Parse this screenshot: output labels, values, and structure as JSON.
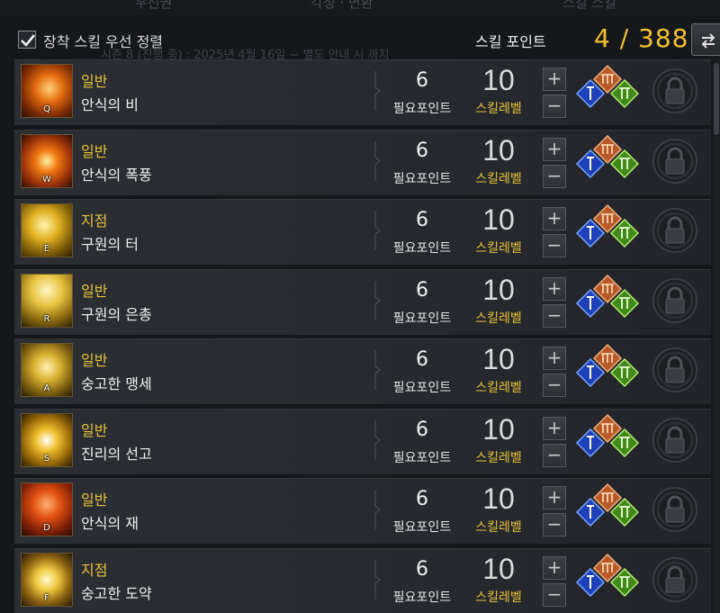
{
  "top": {
    "tabs": [
      "우선권",
      "각성 · 변환",
      "스킬 스킬"
    ],
    "notice": "시즌 8 (진행 중) : 2025년 4월 16일 ~ 별도 안내 시 까지"
  },
  "header": {
    "sort_label": "장착 스킬 우선 정렬",
    "sort_checked": true,
    "skill_point_label": "스킬 포인트",
    "skill_point_value": "4 / 388"
  },
  "labels": {
    "points_label": "필요포인트",
    "level_label": "스킬레벨",
    "plus": "+",
    "minus": "−"
  },
  "colors": {
    "category": "#e8c23a",
    "points_value": "#f2c230"
  },
  "skills": [
    {
      "key": "Q",
      "category": "일반",
      "name": "안식의 비",
      "points": "6",
      "level": "10",
      "icon": "rain-skill-icon"
    },
    {
      "key": "W",
      "category": "일반",
      "name": "안식의 폭풍",
      "points": "6",
      "level": "10",
      "icon": "storm-skill-icon"
    },
    {
      "key": "E",
      "category": "지점",
      "name": "구원의 터",
      "points": "6",
      "level": "10",
      "icon": "salvation-ground-skill-icon"
    },
    {
      "key": "R",
      "category": "일반",
      "name": "구원의 은총",
      "points": "6",
      "level": "10",
      "icon": "grace-skill-icon"
    },
    {
      "key": "A",
      "category": "일반",
      "name": "숭고한 맹세",
      "points": "6",
      "level": "10",
      "icon": "oath-skill-icon"
    },
    {
      "key": "S",
      "category": "일반",
      "name": "진리의 선고",
      "points": "6",
      "level": "10",
      "icon": "verdict-skill-icon"
    },
    {
      "key": "D",
      "category": "일반",
      "name": "안식의 재",
      "points": "6",
      "level": "10",
      "icon": "ash-skill-icon"
    },
    {
      "key": "F",
      "category": "지점",
      "name": "숭고한 도약",
      "points": "6",
      "level": "10",
      "icon": "leap-skill-icon"
    }
  ]
}
